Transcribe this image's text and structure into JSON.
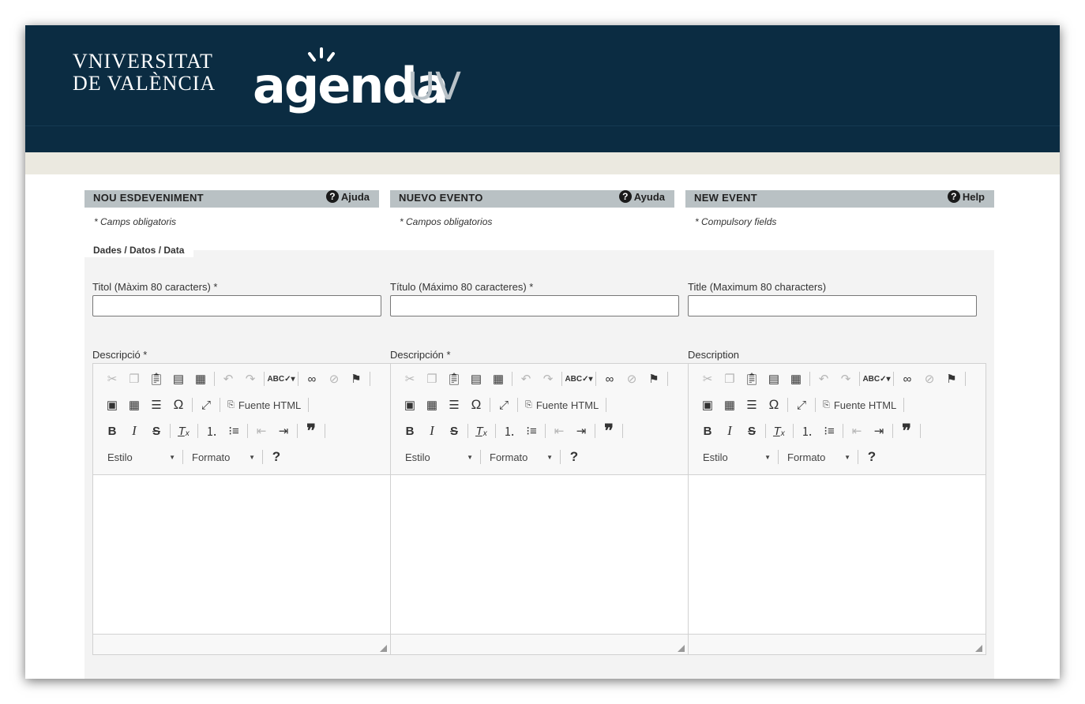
{
  "header": {
    "university_line1": "VNIVERSITAT",
    "university_line2": "DE VALÈNCIA",
    "app_name_main": "agenda",
    "app_name_suffix": "UV"
  },
  "columns": [
    {
      "heading": "NOU ESDEVENIMENT",
      "help_label": "Ajuda",
      "required_note": "* Camps obligatoris",
      "title_label": "Titol (Màxim 80 caracters) *",
      "title_value": "",
      "description_label": "Descripció *"
    },
    {
      "heading": "NUEVO EVENTO",
      "help_label": "Ayuda",
      "required_note": "* Campos obligatorios",
      "title_label": "Título (Máximo 80 caracteres) *",
      "title_value": "",
      "description_label": "Descripción *"
    },
    {
      "heading": "NEW EVENT",
      "help_label": "Help",
      "required_note": "* Compulsory fields",
      "title_label": "Title (Maximum 80 characters)",
      "title_value": "",
      "description_label": "Description"
    }
  ],
  "tab": {
    "label": "Dades / Datos / Data"
  },
  "editor": {
    "source_label": "Fuente HTML",
    "style_label": "Estilo",
    "format_label": "Formato",
    "help_glyph": "?"
  }
}
